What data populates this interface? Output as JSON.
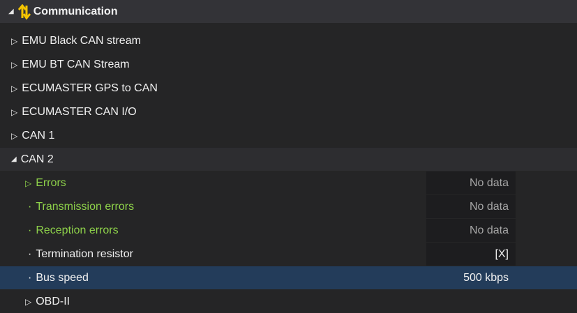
{
  "colors": {
    "green": "#8ed24a",
    "selected": "#233c5a",
    "icon_yellow": "#f5c400"
  },
  "root": {
    "label": "Communication",
    "icon": "communication-arrows-icon"
  },
  "items": [
    {
      "label": "EMU Black CAN stream"
    },
    {
      "label": "EMU BT CAN Stream"
    },
    {
      "label": "ECUMASTER GPS to CAN"
    },
    {
      "label": "ECUMASTER CAN I/O"
    },
    {
      "label": "CAN 1"
    },
    {
      "label": "CAN 2"
    }
  ],
  "can2": [
    {
      "label": "Errors",
      "value": "No data",
      "green": true,
      "kind": "expander"
    },
    {
      "label": "Transmission errors",
      "value": "No data",
      "green": true,
      "kind": "leaf"
    },
    {
      "label": "Reception errors",
      "value": "No data",
      "green": true,
      "kind": "leaf"
    },
    {
      "label": "Termination resistor",
      "value": "[X]",
      "green": false,
      "kind": "leaf"
    },
    {
      "label": "Bus speed",
      "value": "500 kbps",
      "green": false,
      "kind": "leaf",
      "selected": true
    }
  ],
  "obd": {
    "label": "OBD-II"
  },
  "glyphs": {
    "expand": "▷",
    "collapse": "◢",
    "bullet": "·"
  }
}
